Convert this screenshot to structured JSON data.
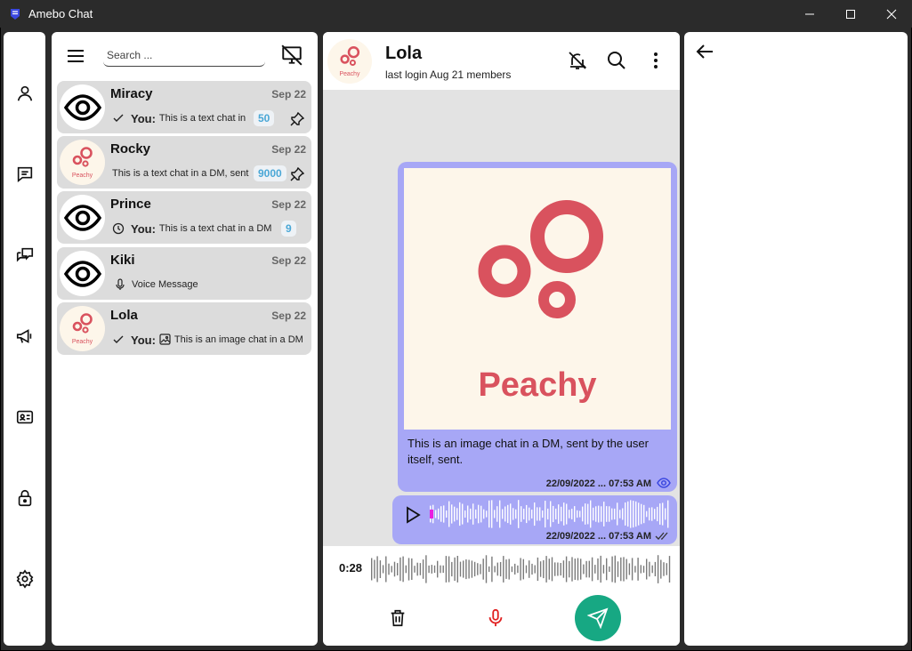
{
  "window": {
    "title": "Amebo Chat"
  },
  "nav": [
    "profile-icon",
    "chats-icon",
    "groups-icon",
    "channels-icon",
    "contacts-icon",
    "lock-icon",
    "settings-icon"
  ],
  "list": {
    "search_placeholder": "Search ...",
    "chats": [
      {
        "name": "Miracy",
        "date": "Sep 22",
        "status_icon": "check-icon",
        "you": "You:",
        "preview": "This is a text chat in",
        "badge": "50",
        "pinned": true,
        "avatar": "eye"
      },
      {
        "name": "Rocky",
        "date": "Sep 22",
        "status_icon": "",
        "you": "",
        "preview": "This is a text chat in a DM, sent",
        "badge": "9000",
        "pinned": true,
        "avatar": "peachy",
        "avatar_label": "Peachy"
      },
      {
        "name": "Prince",
        "date": "Sep 22",
        "status_icon": "clock-icon",
        "you": "You:",
        "preview": "This is a text chat in a DM",
        "badge": "9",
        "pinned": false,
        "avatar": "eye"
      },
      {
        "name": "Kiki",
        "date": "Sep 22",
        "status_icon": "mic-icon",
        "you": "",
        "preview": "Voice Message",
        "badge": "",
        "pinned": false,
        "avatar": "eye"
      },
      {
        "name": "Lola",
        "date": "Sep 22",
        "status_icon": "check-icon",
        "you": "You:",
        "preview": "This is an image chat in a DM",
        "badge": "",
        "pinned": false,
        "avatar": "peachy",
        "avatar_label": "Peachy",
        "media_icon": "image-icon"
      }
    ]
  },
  "conversation": {
    "name": "Lola",
    "subtitle": "last login Aug 21 members",
    "avatar_label": "Peachy",
    "image_message": {
      "image_text": "Peachy",
      "caption": "This is an image chat in a DM, sent by the user itself, sent.",
      "time": "22/09/2022 ... 07:53 AM",
      "status": "seen-icon"
    },
    "voice_message": {
      "time": "22/09/2022 ... 07:53 AM",
      "status": "double-check-icon",
      "progress": 0.0
    },
    "composer": {
      "duration": "0:28"
    }
  },
  "colors": {
    "bubble": "#a7a7f6",
    "accent_send": "#17a883",
    "peachy_red": "#d9525e",
    "badge_text": "#4aa7d6",
    "mic_red": "#e02020"
  }
}
